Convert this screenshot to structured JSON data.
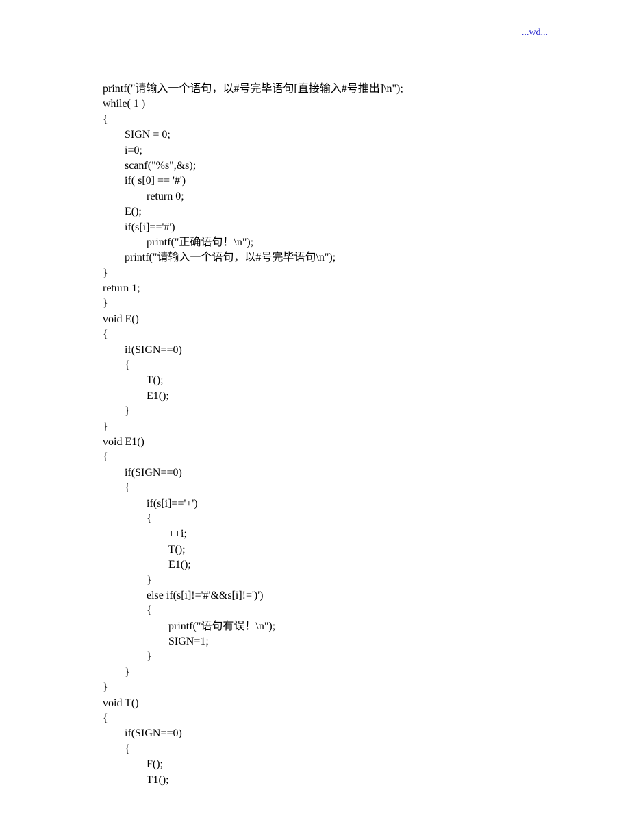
{
  "header": "...wd...",
  "code": "printf(\"请输入一个语句，以#号完毕语句[直接输入#号推出]\\n\");\nwhile( 1 )\n{\n        SIGN = 0;\n        i=0;\n        scanf(\"%s\",&s);\n        if( s[0] == '#')\n                return 0;\n        E();\n        if(s[i]=='#')\n                printf(\"正确语句！\\n\");\n        printf(\"请输入一个语句，以#号完毕语句\\n\");\n}\nreturn 1;\n}\nvoid E()\n{\n        if(SIGN==0)\n        {\n                T();\n                E1();\n        }\n}\nvoid E1()\n{\n        if(SIGN==0)\n        {\n                if(s[i]=='+')\n                {\n                        ++i;\n                        T();\n                        E1();\n                }\n                else if(s[i]!='#'&&s[i]!=')')\n                {\n                        printf(\"语句有误！\\n\");\n                        SIGN=1;\n                }\n        }\n}\nvoid T()\n{\n        if(SIGN==0)\n        {\n                F();\n                T1();"
}
